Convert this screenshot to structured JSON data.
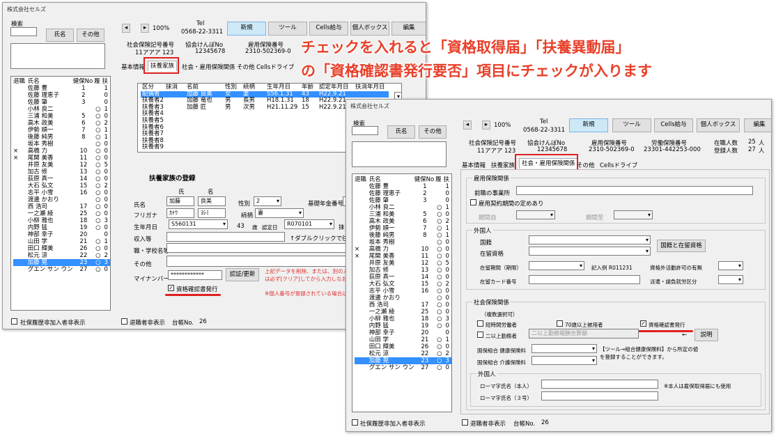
{
  "company": "株式会社セルズ",
  "caption": {
    "line1": "チェックを入れると「資格取得届」「扶養異動届」",
    "line2": "の「資格確認書発行要否」項目にチェックが入ります"
  },
  "toolbar": {
    "zoom": "100%",
    "tel_label": "Tel",
    "tel": "0568-22-3311",
    "new": "新規",
    "tools": "ツール",
    "cells_pay": "Cells給与",
    "inbox": "個人ボックス",
    "edit": "編集",
    "prev": "◂",
    "next": "▸"
  },
  "info": {
    "social_label": "社会保険記号番号",
    "social": "11アアア 123",
    "kyokai_label": "協会けんぽNo",
    "kyokai": "12345678",
    "koyo_label": "雇用保険番号",
    "koyo": "2310-502369-0",
    "rodo_label": "労働保険番号",
    "rodo": "23301-442253-000",
    "zaishoku_label": "在職人数",
    "zaishoku": "25",
    "toroku_label": "登録人数",
    "toroku": "27",
    "unit": "人"
  },
  "search": {
    "label": "検索",
    "name_btn": "氏名",
    "other_btn": "その他"
  },
  "emp_head": [
    "退職",
    "氏名",
    "健保No",
    "履",
    "扶"
  ],
  "employees": [
    {
      "r": "",
      "n": "佐藤 豊",
      "k": "1",
      "h": "",
      "f": "1"
    },
    {
      "r": "",
      "n": "佐藤 理恵子",
      "k": "2",
      "h": "",
      "f": "0"
    },
    {
      "r": "",
      "n": "佐藤 肇",
      "k": "3",
      "h": "",
      "f": "0"
    },
    {
      "r": "",
      "n": "小林 良二",
      "k": "",
      "h": "○",
      "f": "1"
    },
    {
      "r": "",
      "n": "三浦 和美",
      "k": "5",
      "h": "○",
      "f": "0"
    },
    {
      "r": "",
      "n": "高木 政美",
      "k": "6",
      "h": "○",
      "f": "2"
    },
    {
      "r": "",
      "n": "伊勢 順一",
      "k": "7",
      "h": "○",
      "f": "1"
    },
    {
      "r": "",
      "n": "後藤 純男",
      "k": "8",
      "h": "○",
      "f": "1"
    },
    {
      "r": "",
      "n": "坂本 秀樹",
      "k": "",
      "h": "○",
      "f": "0"
    },
    {
      "r": "×",
      "n": "高橋 力",
      "k": "10",
      "h": "○",
      "f": "0"
    },
    {
      "r": "×",
      "n": "尾関 美香",
      "k": "11",
      "h": "○",
      "f": "0"
    },
    {
      "r": "",
      "n": "井原 友美",
      "k": "12",
      "h": "○",
      "f": "5"
    },
    {
      "r": "",
      "n": "加古 修",
      "k": "13",
      "h": "○",
      "f": "0"
    },
    {
      "r": "",
      "n": "荻原 真一",
      "k": "14",
      "h": "○",
      "f": "0"
    },
    {
      "r": "",
      "n": "大石 弘文",
      "k": "15",
      "h": "○",
      "f": "2"
    },
    {
      "r": "",
      "n": "志平 小雪",
      "k": "16",
      "h": "○",
      "f": "0"
    },
    {
      "r": "",
      "n": "渡邊 かおり",
      "k": "",
      "h": "○",
      "f": "0"
    },
    {
      "r": "",
      "n": "西 浩司",
      "k": "17",
      "h": "○",
      "f": "0"
    },
    {
      "r": "",
      "n": "一之瀬 綾",
      "k": "25",
      "h": "○",
      "f": "0"
    },
    {
      "r": "",
      "n": "小柳 雅也",
      "k": "18",
      "h": "○",
      "f": "3"
    },
    {
      "r": "",
      "n": "内野 猛",
      "k": "19",
      "h": "○",
      "f": "0"
    },
    {
      "r": "",
      "n": "神部 幸子",
      "k": "20",
      "h": "",
      "f": "0"
    },
    {
      "r": "",
      "n": "山田 学",
      "k": "21",
      "h": "○",
      "f": "1"
    },
    {
      "r": "",
      "n": "田口 輝美",
      "k": "26",
      "h": "○",
      "f": "0"
    },
    {
      "r": "",
      "n": "松元 涼",
      "k": "22",
      "h": "○",
      "f": "2"
    },
    {
      "r": "",
      "n": "加藤 晃",
      "k": "23",
      "h": "○",
      "f": "3"
    },
    {
      "r": "",
      "n": "グエン サン ウン",
      "k": "27",
      "h": "○",
      "f": "0"
    }
  ],
  "bottom": {
    "hide_social": "社保履歴非加入者非表示",
    "hide_retired": "退職者非表示",
    "ledger_label": "台帳No.",
    "ledger": "26"
  },
  "tabs_back": [
    "基本情報",
    "扶養家族",
    "社会・雇用保険関係",
    "その他",
    "Cellsドライブ"
  ],
  "tabs_front": [
    "基本情報",
    "扶養家族",
    "社会・雇用保険関係",
    "その他",
    "Cellsドライブ"
  ],
  "dep_head": [
    "区分",
    "抹消",
    "名前",
    "性別",
    "続柄",
    "生年月日",
    "年齢",
    "認定年月日",
    "扶消年月日"
  ],
  "dependents": [
    {
      "c": "配偶者",
      "m": "",
      "n": "加藤 良美",
      "s": "女",
      "z": "妻",
      "b": "S56.1.31",
      "a": "43",
      "d": "H22.9.21"
    },
    {
      "c": "扶養者2",
      "m": "",
      "n": "加藤 竜也",
      "s": "男",
      "z": "長男",
      "b": "H18.1.31",
      "a": "18",
      "d": "H22.9.21"
    },
    {
      "c": "扶養者3",
      "m": "",
      "n": "加藤 匠",
      "s": "男",
      "z": "次男",
      "b": "H21.11.29",
      "a": "15",
      "d": "H22.9.21"
    },
    {
      "c": "扶養者4",
      "m": "",
      "n": "",
      "s": "",
      "z": "",
      "b": "",
      "a": "",
      "d": ""
    },
    {
      "c": "扶養者5",
      "m": "",
      "n": "",
      "s": "",
      "z": "",
      "b": "",
      "a": "",
      "d": ""
    },
    {
      "c": "扶養者6",
      "m": "",
      "n": "",
      "s": "",
      "z": "",
      "b": "",
      "a": "",
      "d": ""
    },
    {
      "c": "扶養者7",
      "m": "",
      "n": "",
      "s": "",
      "z": "",
      "b": "",
      "a": "",
      "d": ""
    },
    {
      "c": "扶養者8",
      "m": "",
      "n": "",
      "s": "",
      "z": "",
      "b": "",
      "a": "",
      "d": ""
    },
    {
      "c": "扶養者9",
      "m": "",
      "n": "",
      "s": "",
      "z": "",
      "b": "",
      "a": "",
      "d": ""
    }
  ],
  "reg": {
    "title": "扶養家族の登録",
    "sei": "氏",
    "mei": "名",
    "name_label": "氏名",
    "sei_val": "加藤",
    "mei_val": "良美",
    "gender_label": "性別",
    "gender_val": "2",
    "pension_label": "基礎年金番号",
    "furi_label": "フリガナ",
    "furi_sei": "ｶﾄｳ",
    "furi_mei": "ﾖｼﾐ",
    "rel_label": "続柄",
    "rel_val": "妻",
    "birth_label": "生年月日",
    "birth_val": "S560131",
    "age": "43",
    "age_unit": "歳",
    "cert_label": "認定日",
    "cert_val": "R070101",
    "cut": "抹",
    "income_label": "収入等",
    "dbl_note": "↑ダブルクリックで往保険",
    "job_label": "職・学校名等",
    "other_label": "その他",
    "mynum_label": "マイナンバー",
    "mynum_val": "************",
    "verify_btn": "認証/更新",
    "note1": "上記データを削除、または、別の人に",
    "note2": "は必ず[クリア]してから入力しなおして",
    "check_label": "資格確認書発行",
    "check_mark": "✓",
    "note3": "※個人番号が登録されている場合は"
  },
  "ins": {
    "koyo_group": "雇用保険関係",
    "prev_office": "前職の事業所",
    "contract": "雇用契約期間の定めあり",
    "from": "期間自",
    "to": "期間至",
    "foreign_group": "外国人",
    "nationality": "国籍",
    "status": "在留資格",
    "nat_btn": "国籍と在留資格",
    "period": "在留期間（期限）",
    "example": "記入例 R011231",
    "work_perm": "資格外活動許可の有無",
    "card": "在留カード番号",
    "dispatch": "派遣・請負就労区分",
    "social_group": "社会保険関係",
    "multi": "（複数選択可）",
    "short": "短時間労働者",
    "over70": "70歳以上被用者",
    "cert_check": "資格確認書発行",
    "check_mark": "✓",
    "two_office": "二以上勤務者",
    "two_input": "二以上勤務報酬合算額",
    "arrow": "←",
    "explain": "説明",
    "kumiai1": "国保組合 健康保険料",
    "kumiai2": "国保組合 介護保険料",
    "kumiai_note1": "【ツール→組合健康保険料】から所定の値",
    "kumiai_note2": "を登録することができます。",
    "foreign2": "外国人",
    "roma1": "ローマ字氏名（本人）",
    "roma_note": "※本人は雇保取得届にも使用",
    "roma2": "ローマ字氏名（３号）"
  }
}
